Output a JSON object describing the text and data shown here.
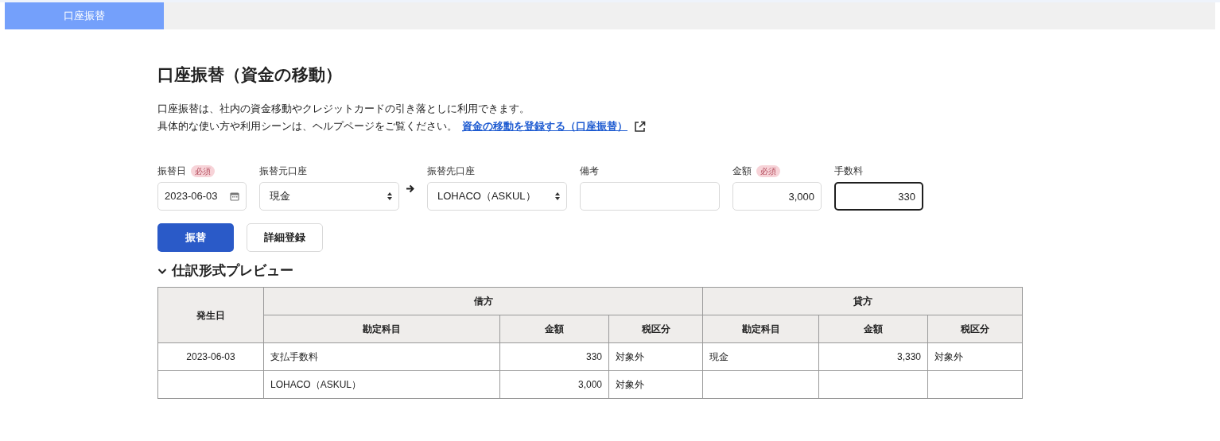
{
  "tabs": [
    {
      "label": "口座振替",
      "selected": true
    }
  ],
  "title": "口座振替（資金の移動）",
  "description": {
    "lines": [
      "口座振替は、社内の資金移動やクレジットカードの引き落としに利用できます。",
      "具体的な使い方や利用シーンは、ヘルプページをご覧ください。"
    ],
    "link": "資金の移動を登録する（口座振替）"
  },
  "fields": [
    {
      "kind": "date",
      "label": "振替日",
      "required": true,
      "required_label": "必須",
      "value": "2023-06-03",
      "focused": false
    },
    {
      "kind": "select",
      "label": "振替元口座",
      "required": false,
      "value": "現金",
      "focused": false
    },
    {
      "kind": "select",
      "label": "振替先口座",
      "required": false,
      "value": "LOHACO（ASKUL）",
      "focused": false
    },
    {
      "kind": "text",
      "label": "備考",
      "required": false,
      "focused": false
    },
    {
      "kind": "number",
      "label": "金額",
      "required": true,
      "required_label": "必須",
      "value": "3,000",
      "focused": false
    },
    {
      "kind": "number",
      "label": "手数料",
      "required": false,
      "value": "330",
      "focused": true
    }
  ],
  "buttons": [
    {
      "label": "振替",
      "kind": "primary"
    },
    {
      "label": "詳細登録",
      "kind": "secondary"
    }
  ],
  "preview": {
    "title": "仕訳形式プレビュー",
    "expanded": true,
    "date_header": "発生日",
    "debit_header": "借方",
    "credit_header": "貸方",
    "sub_headers": [
      "勘定科目",
      "金額",
      "税区分",
      "勘定科目",
      "金額",
      "税区分"
    ],
    "rows": [
      [
        "2023-06-03",
        "支払手数料",
        "330",
        "対象外",
        "現金",
        "3,330",
        "対象外"
      ],
      [
        "",
        "LOHACO（ASKUL）",
        "3,000",
        "対象外",
        "",
        "",
        ""
      ]
    ]
  }
}
